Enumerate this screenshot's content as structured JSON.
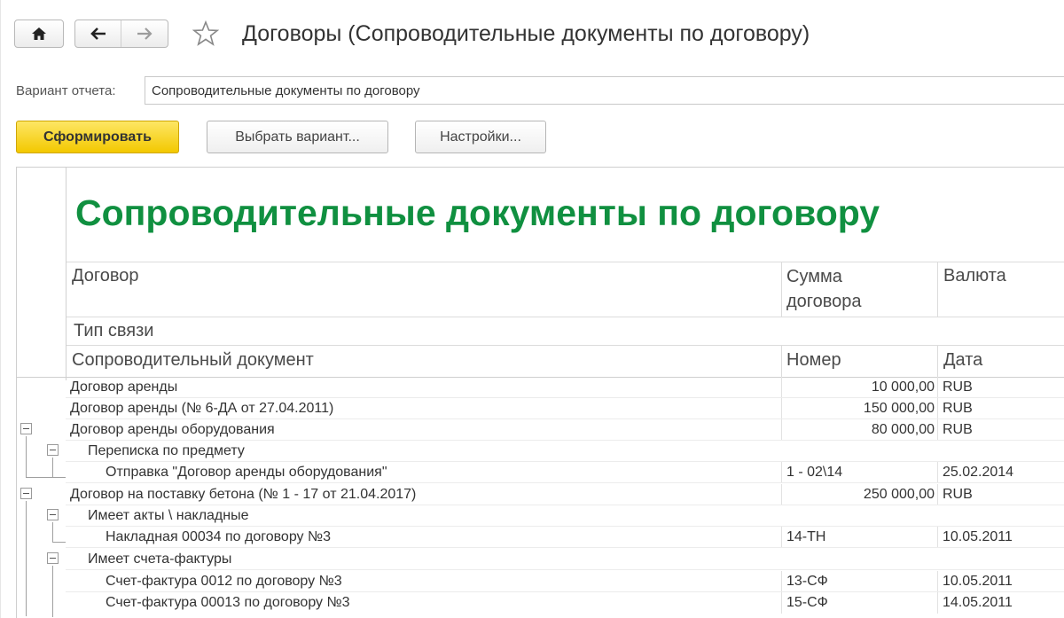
{
  "window": {
    "title": "Договоры (Сопроводительные документы по договору)"
  },
  "variant": {
    "label": "Вариант отчета:",
    "value": "Сопроводительные документы по договору"
  },
  "toolbar": {
    "generate_label": "Сформировать",
    "choose_variant_label": "Выбрать вариант...",
    "settings_label": "Настройки..."
  },
  "report": {
    "title": "Сопроводительные документы по договору",
    "headers": {
      "contract": "Договор",
      "contract_sum": "Сумма договора",
      "currency": "Валюта",
      "link_type": "Тип связи",
      "document": "Сопроводительный документ",
      "number": "Номер",
      "date": "Дата"
    },
    "rows": [
      {
        "text": "Договор аренды",
        "col2": "10 000,00",
        "col3": "RUB"
      },
      {
        "text": "Договор аренды (№ 6-ДА от 27.04.2011)",
        "col2": "150 000,00",
        "col3": "RUB"
      },
      {
        "text": "Договор аренды оборудования",
        "col2": "80 000,00",
        "col3": "RUB"
      },
      {
        "text": "Переписка по предмету",
        "col2": "",
        "col3": ""
      },
      {
        "text": "Отправка \"Договор аренды оборудования\"",
        "col2": "1 - 02\\14",
        "col3": "25.02.2014"
      },
      {
        "text": "Договор на поставку бетона (№ 1 - 17 от 21.04.2017)",
        "col2": "250 000,00",
        "col3": "RUB"
      },
      {
        "text": "Имеет акты \\ накладные",
        "col2": "",
        "col3": ""
      },
      {
        "text": "Накладная 00034 по договору №3",
        "col2": "14-ТН",
        "col3": "10.05.2011"
      },
      {
        "text": "Имеет счета-фактуры",
        "col2": "",
        "col3": ""
      },
      {
        "text": "Счет-фактура 0012 по договору №3",
        "col2": "13-СФ",
        "col3": "10.05.2011"
      },
      {
        "text": "Счет-фактура 00013 по договору №3",
        "col2": "15-СФ",
        "col3": "14.05.2011"
      }
    ]
  },
  "icons": {
    "home": "home-icon",
    "back": "arrow-left-icon",
    "forward": "arrow-right-icon",
    "favorite": "star-icon",
    "collapse": "minus-box-icon"
  },
  "colors": {
    "report_title": "#109040",
    "primary_button": "#f7d117"
  }
}
